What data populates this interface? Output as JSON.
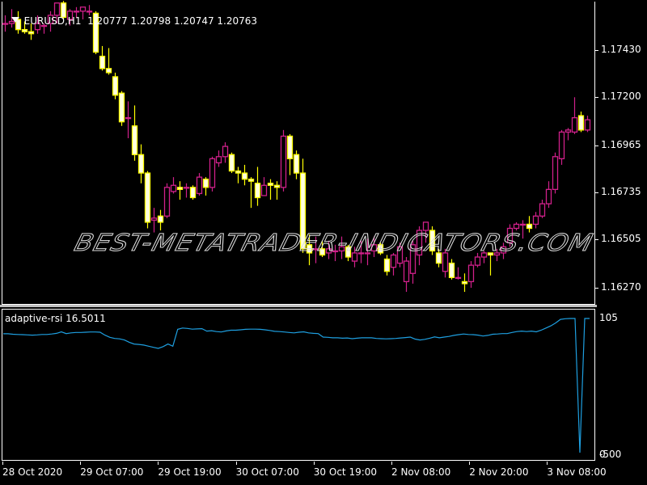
{
  "header": {
    "symbol_timeframe": "EURUSD,H1",
    "ohlc_readout": "1.20777 1.20798 1.20747 1.20763"
  },
  "subwindow": {
    "indicator_label": "adaptive-rsi 16.5011",
    "scale_top": "105",
    "scale_bottom": "-500",
    "scale_bottom_overlap": "0",
    "line_color": "#1e9fe0"
  },
  "price_axis": {
    "labels": [
      "1.17430",
      "1.17200",
      "1.16965",
      "1.16735",
      "1.16505",
      "1.16270"
    ]
  },
  "time_axis": {
    "labels": [
      "28 Oct 2020",
      "29 Oct 07:00",
      "29 Oct 19:00",
      "30 Oct 07:00",
      "30 Oct 19:00",
      "2 Nov 08:00",
      "2 Nov 20:00",
      "3 Nov 08:00"
    ]
  },
  "watermark": "BEST-METATRADER-INDICATORS.COM",
  "colors": {
    "background": "#000000",
    "bull_candle": "#d0208a",
    "bear_candle_outline": "#ffff00",
    "bear_candle_fill": "#ffffe0",
    "rsi_line": "#1e9fe0"
  },
  "chart_data": [
    {
      "type": "candlestick",
      "title": "EURUSD,H1",
      "y_range": [
        1.1615,
        1.1782
      ],
      "candles": [
        {
          "o": 1.1756,
          "h": 1.176,
          "l": 1.1752,
          "c": 1.1756
        },
        {
          "o": 1.1756,
          "h": 1.1763,
          "l": 1.1754,
          "c": 1.1757
        },
        {
          "o": 1.1758,
          "h": 1.1762,
          "l": 1.1751,
          "c": 1.1753
        },
        {
          "o": 1.1753,
          "h": 1.1757,
          "l": 1.1751,
          "c": 1.1752
        },
        {
          "o": 1.1752,
          "h": 1.1756,
          "l": 1.1748,
          "c": 1.1751
        },
        {
          "o": 1.1753,
          "h": 1.176,
          "l": 1.1751,
          "c": 1.1756
        },
        {
          "o": 1.1755,
          "h": 1.1756,
          "l": 1.1751,
          "c": 1.1755
        },
        {
          "o": 1.1756,
          "h": 1.1762,
          "l": 1.1752,
          "c": 1.176
        },
        {
          "o": 1.176,
          "h": 1.1766,
          "l": 1.1756,
          "c": 1.1766
        },
        {
          "o": 1.1766,
          "h": 1.1767,
          "l": 1.1758,
          "c": 1.1759
        },
        {
          "o": 1.1758,
          "h": 1.1763,
          "l": 1.1755,
          "c": 1.1762
        },
        {
          "o": 1.1762,
          "h": 1.1764,
          "l": 1.1759,
          "c": 1.1762
        },
        {
          "o": 1.1762,
          "h": 1.1764,
          "l": 1.1758,
          "c": 1.1764
        },
        {
          "o": 1.1762,
          "h": 1.1765,
          "l": 1.176,
          "c": 1.1762
        },
        {
          "o": 1.1761,
          "h": 1.1762,
          "l": 1.1741,
          "c": 1.1742
        },
        {
          "o": 1.174,
          "h": 1.1745,
          "l": 1.1733,
          "c": 1.1734
        },
        {
          "o": 1.1734,
          "h": 1.1744,
          "l": 1.1731,
          "c": 1.1732
        },
        {
          "o": 1.173,
          "h": 1.1732,
          "l": 1.1719,
          "c": 1.1721
        },
        {
          "o": 1.1722,
          "h": 1.1723,
          "l": 1.1706,
          "c": 1.1708
        },
        {
          "o": 1.171,
          "h": 1.1718,
          "l": 1.17,
          "c": 1.171
        },
        {
          "o": 1.1706,
          "h": 1.1716,
          "l": 1.1689,
          "c": 1.1692
        },
        {
          "o": 1.1692,
          "h": 1.1697,
          "l": 1.1678,
          "c": 1.1683
        },
        {
          "o": 1.1683,
          "h": 1.1684,
          "l": 1.1656,
          "c": 1.1659
        },
        {
          "o": 1.166,
          "h": 1.1666,
          "l": 1.1654,
          "c": 1.1661
        },
        {
          "o": 1.1662,
          "h": 1.1665,
          "l": 1.1655,
          "c": 1.1659
        },
        {
          "o": 1.1662,
          "h": 1.1678,
          "l": 1.1661,
          "c": 1.1676
        },
        {
          "o": 1.1674,
          "h": 1.1681,
          "l": 1.1673,
          "c": 1.1677
        },
        {
          "o": 1.1676,
          "h": 1.1679,
          "l": 1.167,
          "c": 1.1675
        },
        {
          "o": 1.1676,
          "h": 1.1678,
          "l": 1.1671,
          "c": 1.1676
        },
        {
          "o": 1.1676,
          "h": 1.1677,
          "l": 1.167,
          "c": 1.1671
        },
        {
          "o": 1.1673,
          "h": 1.1683,
          "l": 1.1672,
          "c": 1.1681
        },
        {
          "o": 1.168,
          "h": 1.1681,
          "l": 1.1672,
          "c": 1.1676
        },
        {
          "o": 1.1676,
          "h": 1.1691,
          "l": 1.1674,
          "c": 1.169
        },
        {
          "o": 1.1688,
          "h": 1.1694,
          "l": 1.1686,
          "c": 1.1691
        },
        {
          "o": 1.1691,
          "h": 1.1698,
          "l": 1.1688,
          "c": 1.1696
        },
        {
          "o": 1.1692,
          "h": 1.1693,
          "l": 1.1683,
          "c": 1.1684
        },
        {
          "o": 1.1684,
          "h": 1.1686,
          "l": 1.1678,
          "c": 1.1683
        },
        {
          "o": 1.1683,
          "h": 1.1687,
          "l": 1.1677,
          "c": 1.168
        },
        {
          "o": 1.168,
          "h": 1.1681,
          "l": 1.1666,
          "c": 1.1679
        },
        {
          "o": 1.1678,
          "h": 1.1686,
          "l": 1.1667,
          "c": 1.1671
        },
        {
          "o": 1.1672,
          "h": 1.1681,
          "l": 1.1672,
          "c": 1.1677
        },
        {
          "o": 1.1678,
          "h": 1.168,
          "l": 1.167,
          "c": 1.1677
        },
        {
          "o": 1.1677,
          "h": 1.1679,
          "l": 1.167,
          "c": 1.1676
        },
        {
          "o": 1.1676,
          "h": 1.1704,
          "l": 1.1674,
          "c": 1.1701
        },
        {
          "o": 1.1701,
          "h": 1.1702,
          "l": 1.1682,
          "c": 1.169
        },
        {
          "o": 1.1692,
          "h": 1.1694,
          "l": 1.168,
          "c": 1.1683
        },
        {
          "o": 1.1683,
          "h": 1.169,
          "l": 1.1644,
          "c": 1.1646
        },
        {
          "o": 1.1648,
          "h": 1.1653,
          "l": 1.1638,
          "c": 1.1644
        },
        {
          "o": 1.1646,
          "h": 1.1652,
          "l": 1.1639,
          "c": 1.1646
        },
        {
          "o": 1.1646,
          "h": 1.165,
          "l": 1.1642,
          "c": 1.1643
        },
        {
          "o": 1.1644,
          "h": 1.165,
          "l": 1.1641,
          "c": 1.1646
        },
        {
          "o": 1.1645,
          "h": 1.1648,
          "l": 1.164,
          "c": 1.1645
        },
        {
          "o": 1.1645,
          "h": 1.1652,
          "l": 1.1641,
          "c": 1.1647
        },
        {
          "o": 1.1647,
          "h": 1.1648,
          "l": 1.164,
          "c": 1.1642
        },
        {
          "o": 1.164,
          "h": 1.1647,
          "l": 1.1637,
          "c": 1.1644
        },
        {
          "o": 1.1644,
          "h": 1.165,
          "l": 1.1639,
          "c": 1.1644
        },
        {
          "o": 1.1644,
          "h": 1.1651,
          "l": 1.1638,
          "c": 1.1644
        },
        {
          "o": 1.1645,
          "h": 1.1652,
          "l": 1.1642,
          "c": 1.1648
        },
        {
          "o": 1.1648,
          "h": 1.1649,
          "l": 1.1643,
          "c": 1.1644
        },
        {
          "o": 1.1641,
          "h": 1.1643,
          "l": 1.1633,
          "c": 1.1635
        },
        {
          "o": 1.1637,
          "h": 1.1644,
          "l": 1.1633,
          "c": 1.1643
        },
        {
          "o": 1.1639,
          "h": 1.1649,
          "l": 1.1637,
          "c": 1.1647
        },
        {
          "o": 1.163,
          "h": 1.1642,
          "l": 1.1625,
          "c": 1.164
        },
        {
          "o": 1.1634,
          "h": 1.165,
          "l": 1.1629,
          "c": 1.1648
        },
        {
          "o": 1.1643,
          "h": 1.1657,
          "l": 1.1638,
          "c": 1.1655
        },
        {
          "o": 1.1655,
          "h": 1.1658,
          "l": 1.1649,
          "c": 1.1659
        },
        {
          "o": 1.1655,
          "h": 1.1657,
          "l": 1.1643,
          "c": 1.1645
        },
        {
          "o": 1.1644,
          "h": 1.1646,
          "l": 1.1637,
          "c": 1.1639
        },
        {
          "o": 1.1635,
          "h": 1.1646,
          "l": 1.1632,
          "c": 1.1644
        },
        {
          "o": 1.1639,
          "h": 1.1641,
          "l": 1.1631,
          "c": 1.1632
        },
        {
          "o": 1.1632,
          "h": 1.1637,
          "l": 1.1631,
          "c": 1.1632
        },
        {
          "o": 1.163,
          "h": 1.1634,
          "l": 1.1625,
          "c": 1.1629
        },
        {
          "o": 1.163,
          "h": 1.164,
          "l": 1.1627,
          "c": 1.1638
        },
        {
          "o": 1.1638,
          "h": 1.1644,
          "l": 1.1637,
          "c": 1.1642
        },
        {
          "o": 1.1642,
          "h": 1.1645,
          "l": 1.1639,
          "c": 1.1644
        },
        {
          "o": 1.1644,
          "h": 1.1644,
          "l": 1.1633,
          "c": 1.1643
        },
        {
          "o": 1.1643,
          "h": 1.1646,
          "l": 1.164,
          "c": 1.1644
        },
        {
          "o": 1.1644,
          "h": 1.1649,
          "l": 1.1641,
          "c": 1.1647
        },
        {
          "o": 1.1649,
          "h": 1.1658,
          "l": 1.1647,
          "c": 1.1656
        },
        {
          "o": 1.1656,
          "h": 1.1659,
          "l": 1.1655,
          "c": 1.1658
        },
        {
          "o": 1.1658,
          "h": 1.166,
          "l": 1.1651,
          "c": 1.1658
        },
        {
          "o": 1.1658,
          "h": 1.1662,
          "l": 1.1654,
          "c": 1.1656
        },
        {
          "o": 1.1658,
          "h": 1.1664,
          "l": 1.1656,
          "c": 1.1662
        },
        {
          "o": 1.1662,
          "h": 1.167,
          "l": 1.1661,
          "c": 1.1668
        },
        {
          "o": 1.1668,
          "h": 1.1679,
          "l": 1.1666,
          "c": 1.1675
        },
        {
          "o": 1.1675,
          "h": 1.1693,
          "l": 1.1673,
          "c": 1.1691
        },
        {
          "o": 1.169,
          "h": 1.1704,
          "l": 1.1687,
          "c": 1.1703
        },
        {
          "o": 1.1703,
          "h": 1.1705,
          "l": 1.1699,
          "c": 1.1704
        },
        {
          "o": 1.1703,
          "h": 1.172,
          "l": 1.1702,
          "c": 1.171
        },
        {
          "o": 1.1711,
          "h": 1.1713,
          "l": 1.1703,
          "c": 1.1704
        },
        {
          "o": 1.1704,
          "h": 1.1711,
          "l": 1.1703,
          "c": 1.1709
        }
      ],
      "y_ticks": [
        1.1743,
        1.172,
        1.16965,
        1.16735,
        1.16505,
        1.1627
      ]
    },
    {
      "type": "line",
      "title": "adaptive-rsi 16.5011",
      "y_range": [
        -500,
        105
      ],
      "values": [
        36,
        36,
        34,
        33,
        32,
        31,
        30,
        31,
        33,
        33,
        35,
        38,
        45,
        37,
        40,
        42,
        42,
        43,
        44,
        44,
        43,
        30,
        20,
        15,
        13,
        8,
        -2,
        -10,
        -12,
        -15,
        -20,
        -25,
        -30,
        -22,
        -10,
        -20,
        56,
        62,
        60,
        57,
        58,
        59,
        48,
        50,
        46,
        44,
        49,
        52,
        52,
        54,
        56,
        57,
        57,
        56,
        54,
        51,
        47,
        46,
        44,
        42,
        40,
        43,
        45,
        40,
        38,
        37,
        21,
        20,
        18,
        18,
        16,
        17,
        14,
        16,
        18,
        18,
        18,
        15,
        14,
        13,
        14,
        15,
        17,
        19,
        21,
        12,
        8,
        11,
        16,
        22,
        18,
        21,
        24,
        29,
        32,
        35,
        33,
        32,
        30,
        26,
        29,
        34,
        35,
        37,
        37,
        42,
        46,
        48,
        46,
        48,
        45,
        52,
        62,
        72,
        85,
        101,
        104,
        105,
        105,
        -500,
        105,
        105
      ]
    }
  ]
}
